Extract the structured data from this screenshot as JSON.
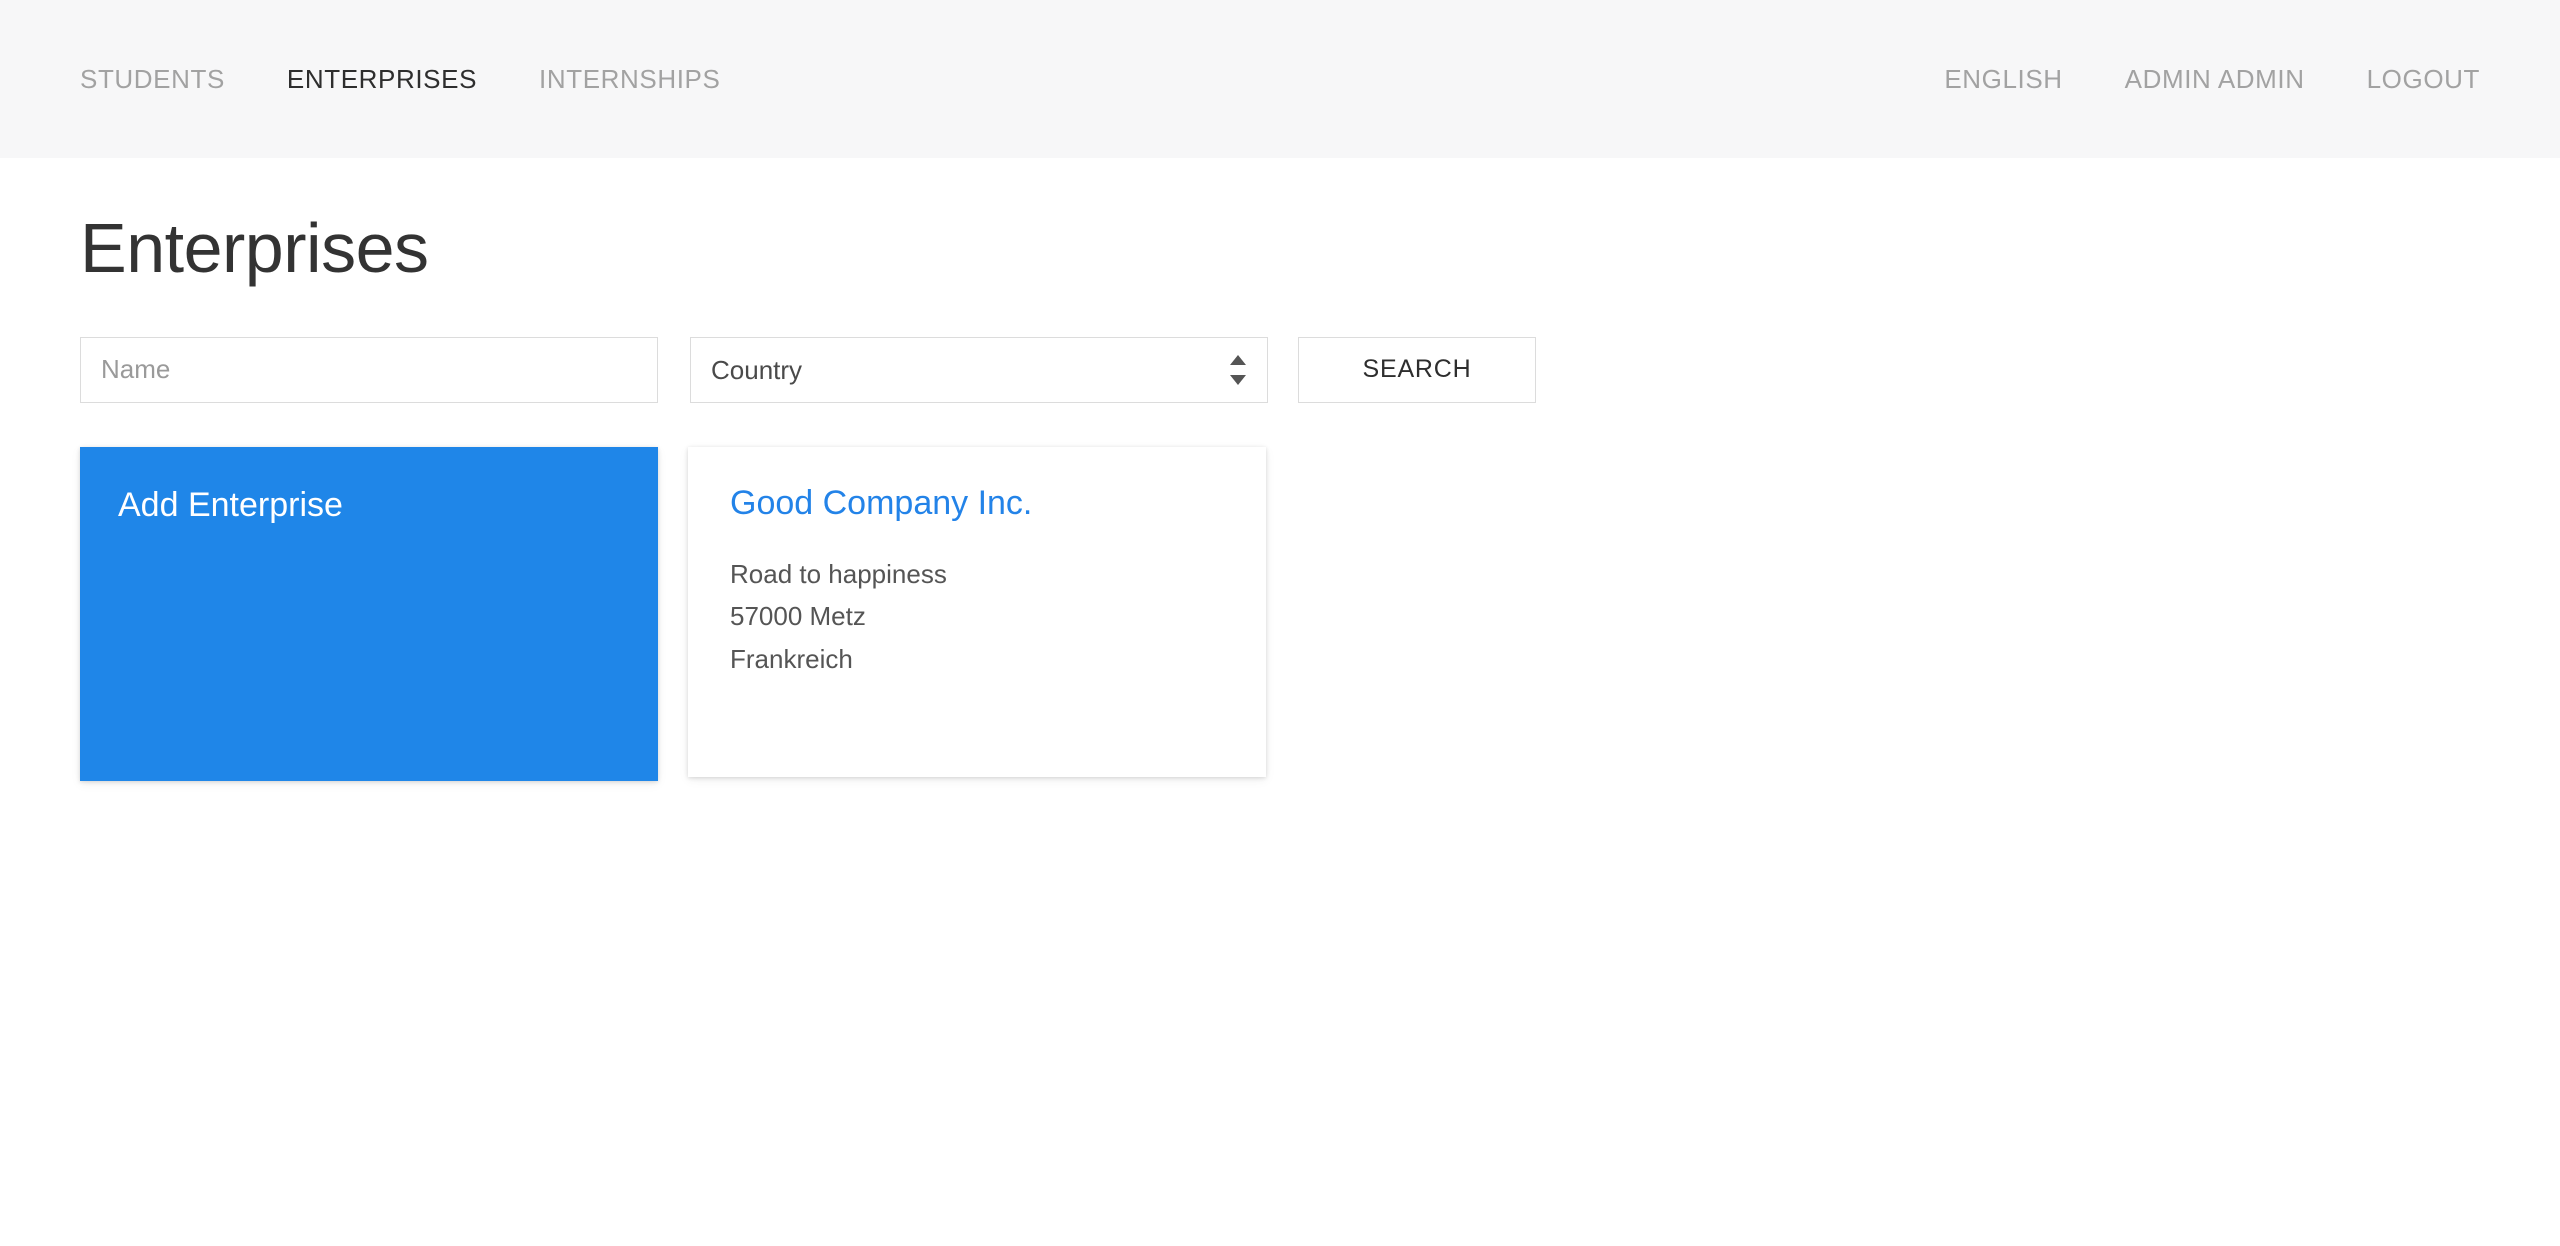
{
  "navbar": {
    "left_links": [
      {
        "label": "STUDENTS",
        "active": false,
        "name": "nav-link-students"
      },
      {
        "label": "ENTERPRISES",
        "active": true,
        "name": "nav-link-enterprises"
      },
      {
        "label": "INTERNSHIPS",
        "active": false,
        "name": "nav-link-internships"
      }
    ],
    "right_links": [
      {
        "label": "ENGLISH",
        "name": "nav-link-language"
      },
      {
        "label": "ADMIN ADMIN",
        "name": "nav-link-user"
      },
      {
        "label": "LOGOUT",
        "name": "nav-link-logout"
      }
    ]
  },
  "page": {
    "title": "Enterprises"
  },
  "filters": {
    "name_input": {
      "placeholder": "Name",
      "value": ""
    },
    "country_select": {
      "selected": "Country",
      "options": [
        "Country"
      ]
    },
    "search_button": {
      "label": "SEARCH"
    }
  },
  "cards": {
    "add_enterprise": {
      "label": "Add Enterprise"
    },
    "enterprises": [
      {
        "name": "Good Company Inc.",
        "street": "Road to happiness",
        "city": "57000 Metz",
        "country": "Frankreich"
      }
    ]
  },
  "colors": {
    "accent_blue": "#1f86e8",
    "link_blue": "#2383e8",
    "navbar_bg": "#f7f7f8",
    "nav_inactive": "#a2a2a2",
    "nav_active": "#2e2e2e",
    "field_border": "#dcdcdc",
    "body_text": "#555555",
    "title_text": "#333333"
  }
}
